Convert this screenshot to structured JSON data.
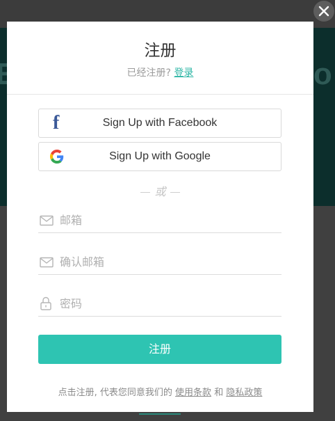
{
  "background": {
    "left_fragment": "E",
    "right_fragment": "go"
  },
  "modal": {
    "title": "注册",
    "subtitle_prefix": "已经注册?",
    "login_link": "登录",
    "facebook_button": "Sign Up with Facebook",
    "google_button": "Sign Up with Google",
    "or_text": "或",
    "fields": {
      "email_placeholder": "邮箱",
      "confirm_email_placeholder": "确认邮箱",
      "password_placeholder": "密码"
    },
    "submit_label": "注册",
    "terms": {
      "prefix": "点击注册, 代表您同意我们的",
      "terms_link": "使用条款",
      "conjunction": "和",
      "privacy_link": "隐私政策"
    }
  },
  "icons": {
    "close": "close-icon",
    "facebook": "facebook-icon",
    "google": "google-icon",
    "email": "envelope-icon",
    "password": "lock-icon"
  },
  "colors": {
    "accent": "#2ec4b2",
    "link": "#2bb5a4",
    "facebook": "#3b5998",
    "overlay": "#3c3c3c"
  }
}
